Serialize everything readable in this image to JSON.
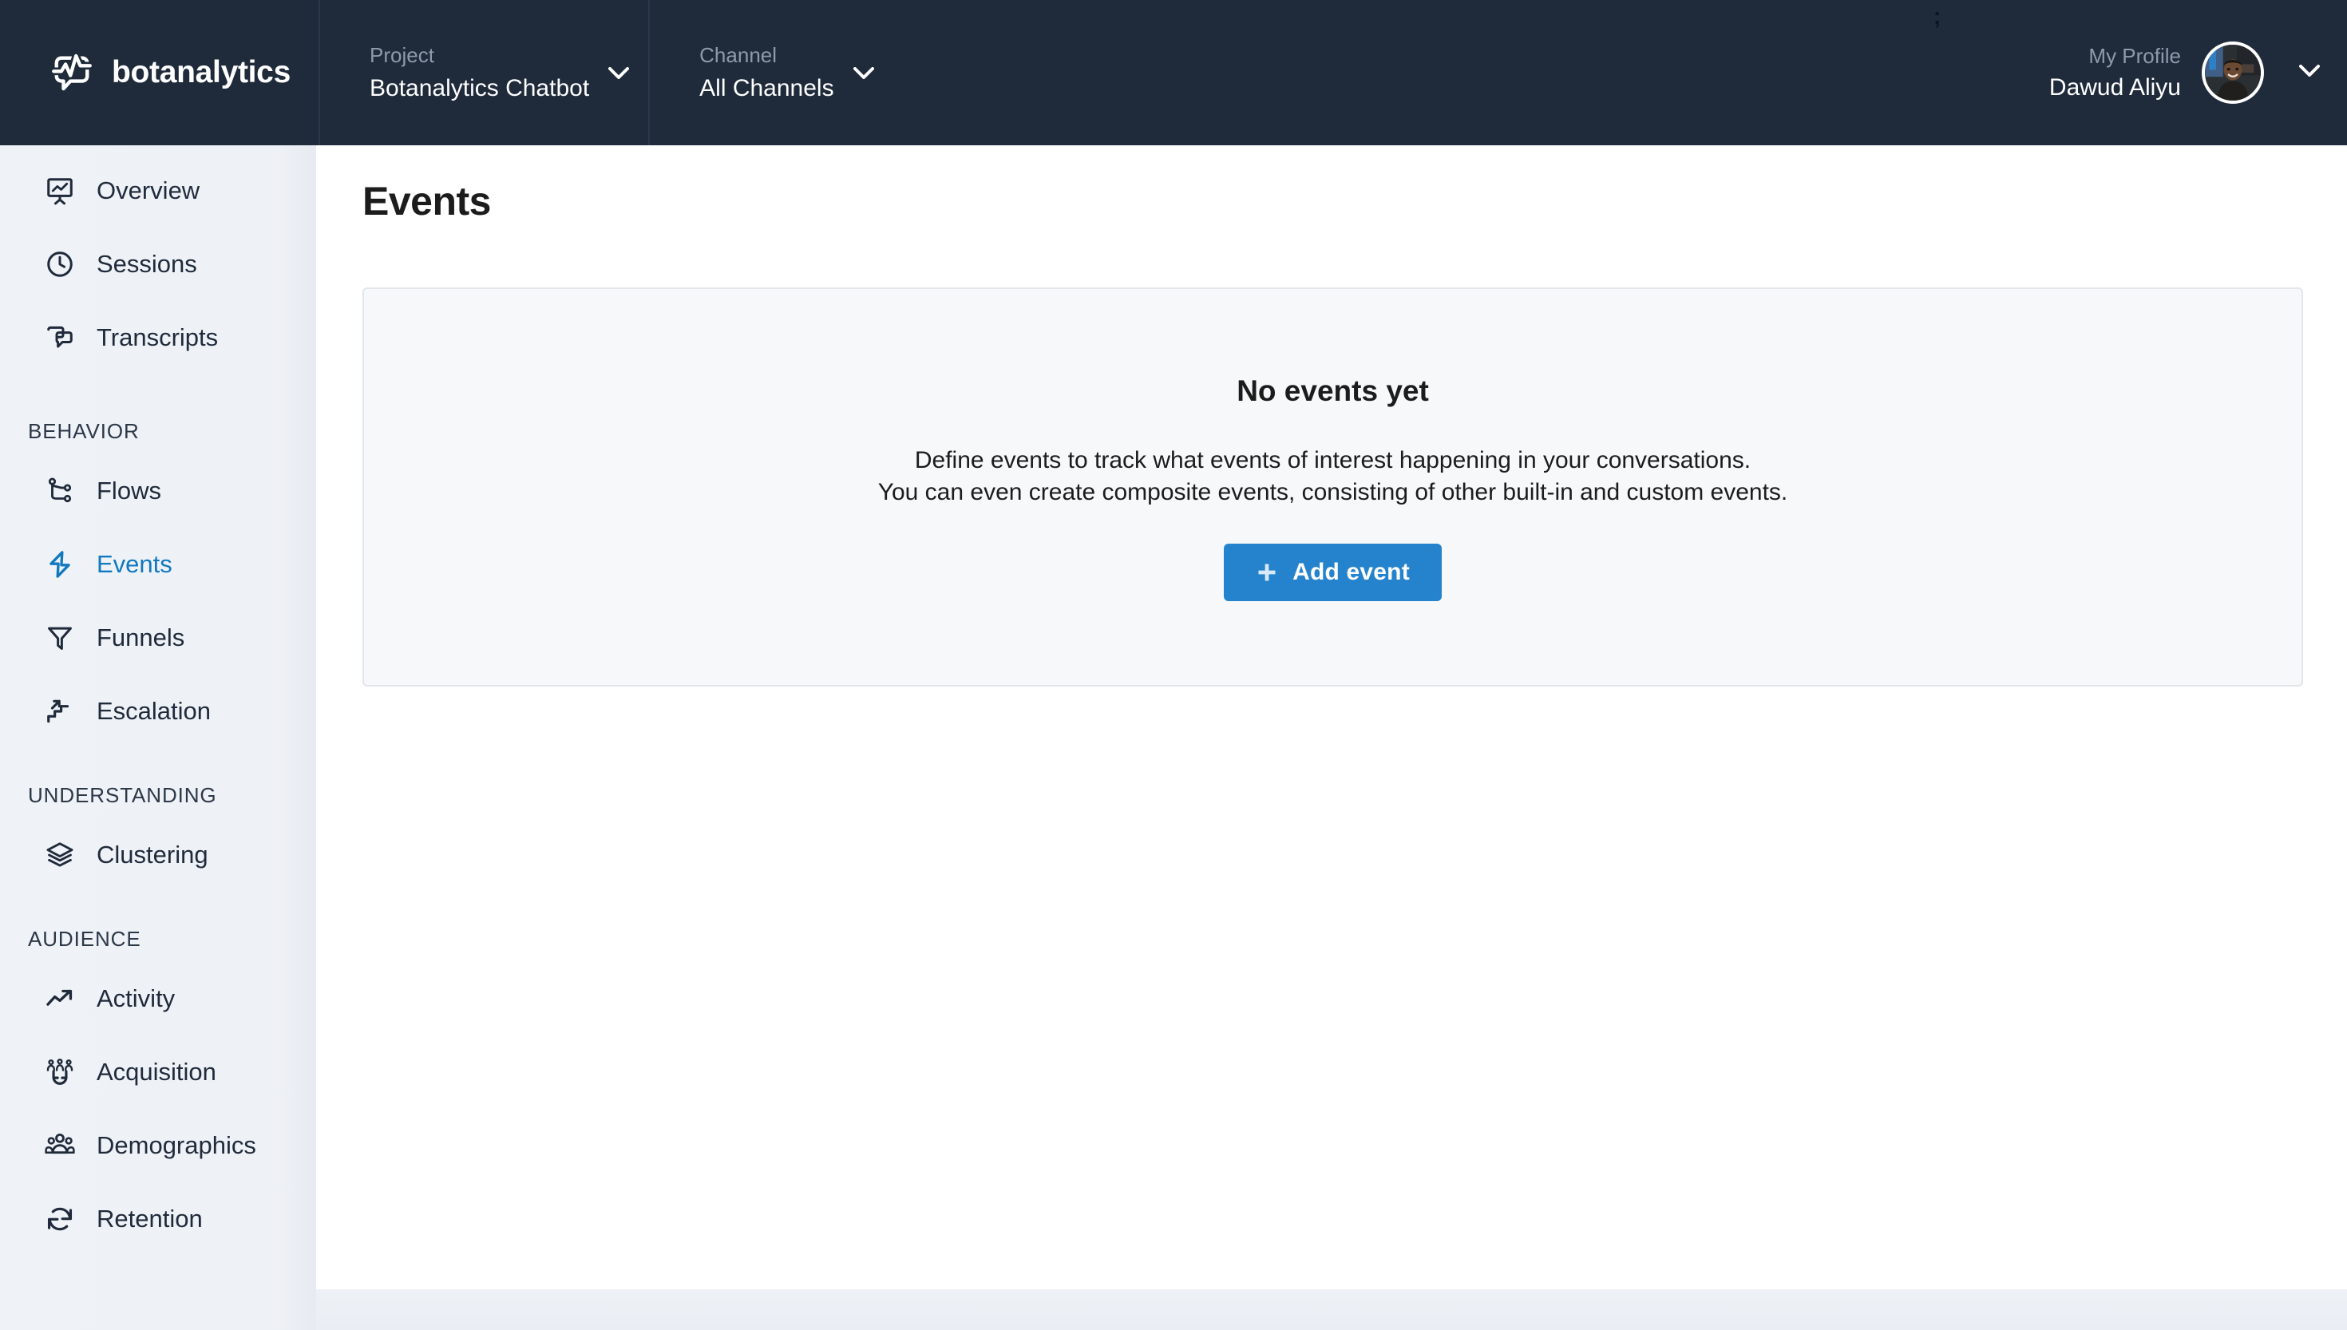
{
  "brand": {
    "name": "botanalytics",
    "logo_icon": "chat-bubble-chart-logo"
  },
  "header": {
    "project": {
      "label": "Project",
      "value": "Botanalytics Chatbot",
      "chevron_icon": "chevron-down-icon"
    },
    "channel": {
      "label": "Channel",
      "value": "All Channels",
      "chevron_icon": "chevron-down-icon"
    },
    "drag_handle": ";",
    "profile": {
      "label": "My Profile",
      "name": "Dawud Aliyu",
      "avatar_icon": "user-photo-avatar",
      "chevron_icon": "chevron-down-icon"
    },
    "background_color": "#1f2a3b"
  },
  "sidebar": {
    "background_color": "#eef1f6",
    "active_color": "#1179bf",
    "groups": [
      {
        "title": null,
        "items": [
          {
            "label": "Overview",
            "icon": "presentation-chart-icon",
            "active": false
          },
          {
            "label": "Sessions",
            "icon": "clock-icon",
            "active": false
          },
          {
            "label": "Transcripts",
            "icon": "chat-bubbles-icon",
            "active": false
          }
        ]
      },
      {
        "title": "BEHAVIOR",
        "items": [
          {
            "label": "Flows",
            "icon": "flow-branch-icon",
            "active": false
          },
          {
            "label": "Events",
            "icon": "lightning-bolt-icon",
            "active": true
          },
          {
            "label": "Funnels",
            "icon": "funnel-icon",
            "active": false
          },
          {
            "label": "Escalation",
            "icon": "stairs-arrow-icon",
            "active": false
          }
        ]
      },
      {
        "title": "UNDERSTANDING",
        "items": [
          {
            "label": "Clustering",
            "icon": "layers-icon",
            "active": false
          }
        ]
      },
      {
        "title": "AUDIENCE",
        "items": [
          {
            "label": "Activity",
            "icon": "trending-up-icon",
            "active": false
          },
          {
            "label": "Acquisition",
            "icon": "magnet-people-icon",
            "active": false
          },
          {
            "label": "Demographics",
            "icon": "people-group-icon",
            "active": false
          },
          {
            "label": "Retention",
            "icon": "refresh-cycle-icon",
            "active": false
          }
        ]
      }
    ]
  },
  "main": {
    "page_title": "Events",
    "empty_state": {
      "title": "No events yet",
      "description_line_1": "Define events to track what events of interest happening in your conversations.",
      "description_line_2": "You can even create composite events, consisting of other built-in and custom events.",
      "button_label": "Add event",
      "button_icon": "plus-icon",
      "button_color": "#2583cd"
    }
  }
}
